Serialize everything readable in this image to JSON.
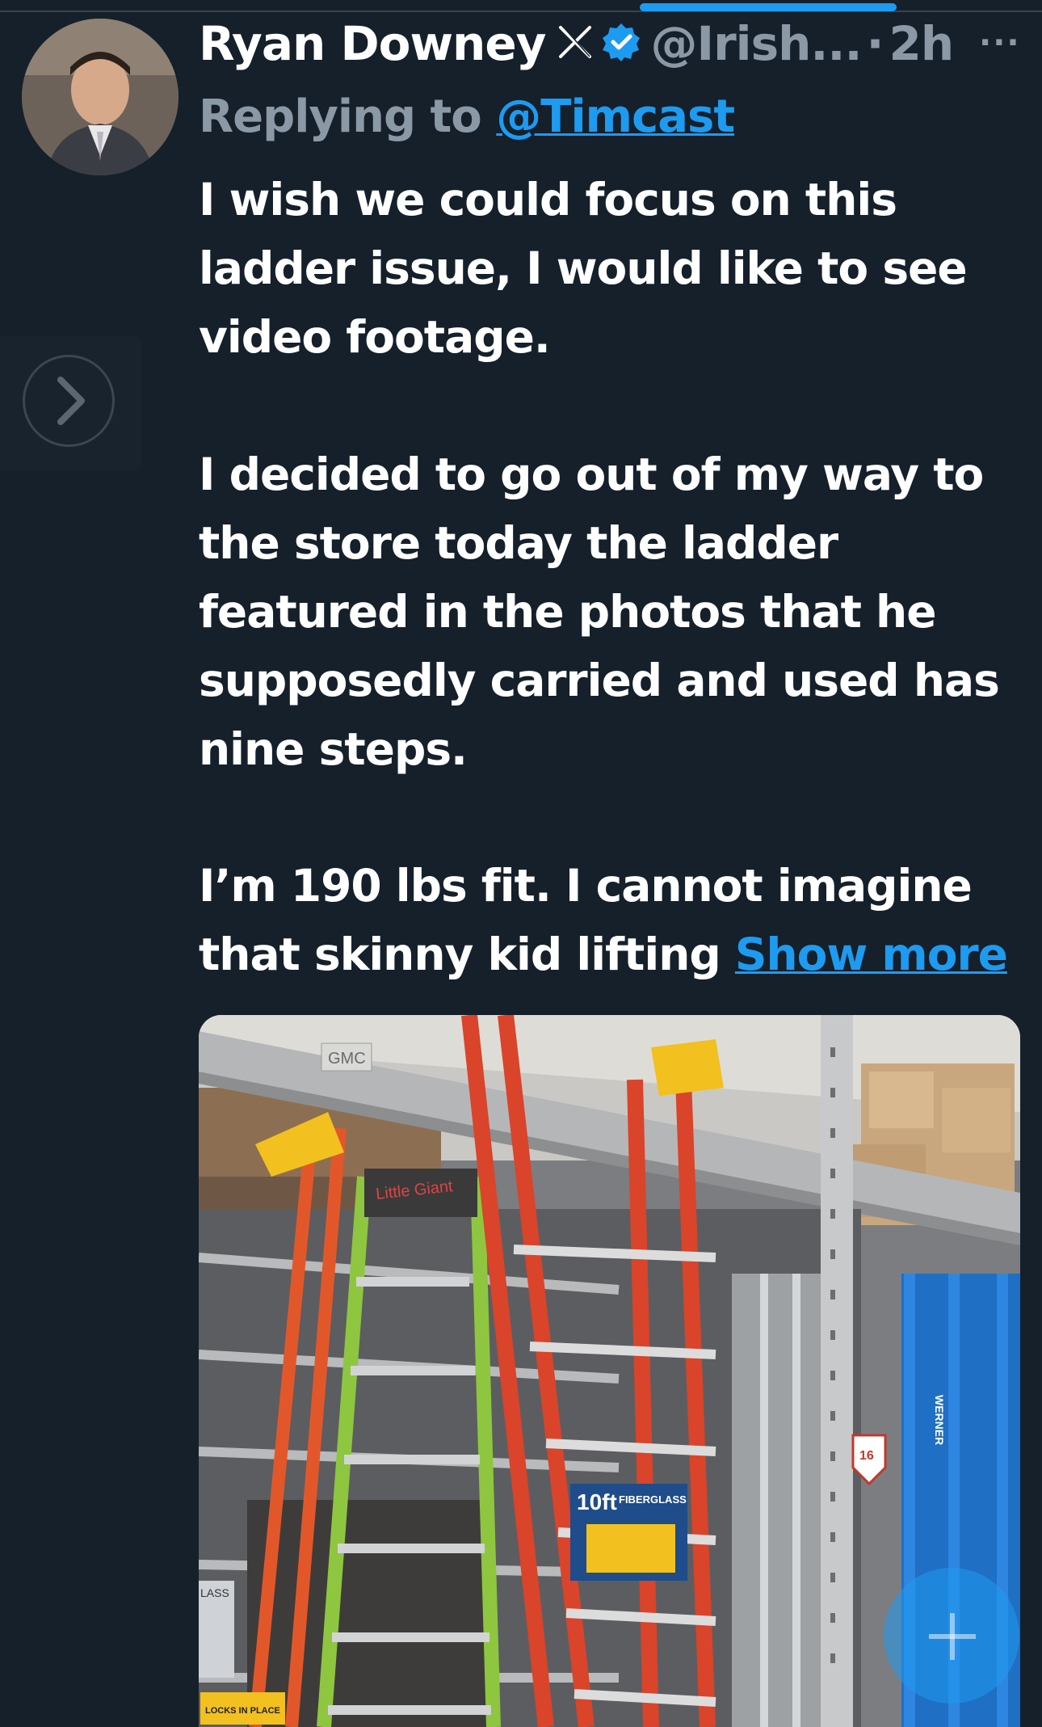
{
  "tweet": {
    "author_name": "Ryan Downey",
    "handle": "@Irish...",
    "separator": "·",
    "time": "2h",
    "more_label": "···",
    "replying_prefix": "Replying to",
    "replying_to": "@Timcast",
    "paragraph_1": "I wish we could focus on this ladder issue, I would like to see video footage.",
    "paragraph_2": "I decided to go out of my way to the store today the ladder featured in the photos that he supposedly carried and used has nine steps.",
    "paragraph_3": "I’m 190 lbs fit.  I cannot imagine that skinny kid lifting",
    "show_more": "Show more"
  },
  "photo_text": {
    "shelf_tag": "GMC",
    "box_size": "10ft",
    "box_material": "FIBERGLASS",
    "aisle_number": "16",
    "sign_text": "LOCKS IN PLACE",
    "brand_a": "Little Giant",
    "brand_b": "WERNER",
    "side_text": "LASS"
  },
  "colors": {
    "background": "#15202b",
    "accent": "#1d9bf0",
    "muted": "#8b98a5",
    "text": "#ffffff"
  },
  "icons": {
    "x_logo": "x-logo-icon",
    "verified": "verified-badge-icon",
    "more": "more-icon",
    "arrow": "chevron-right-icon",
    "fab": "compose-plus-icon"
  }
}
